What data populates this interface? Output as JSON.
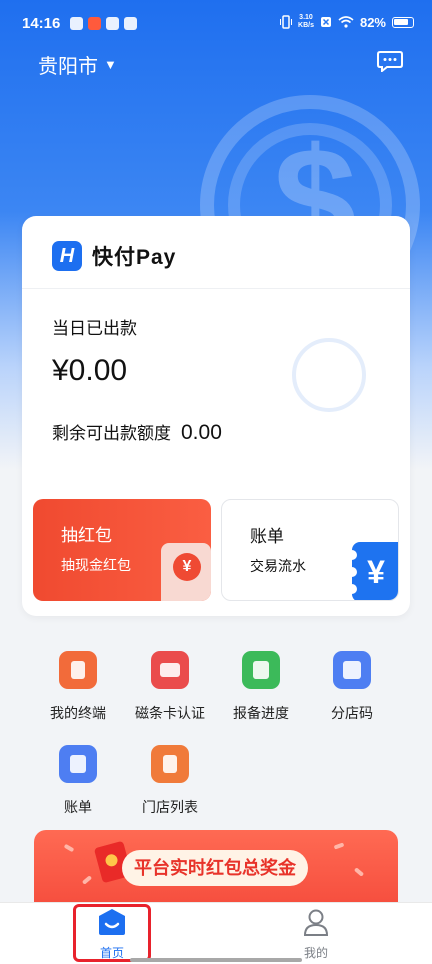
{
  "status_bar": {
    "time": "14:16",
    "net_speed_value": "3.10",
    "net_speed_unit": "KB/s",
    "battery": "82%"
  },
  "header": {
    "city": "贵阳市",
    "message_icon": "chat-bubble-icon"
  },
  "brand": {
    "logo_letter": "H",
    "name": "快付Pay"
  },
  "summary": {
    "today_label": "当日已出款",
    "today_amount": "¥0.00",
    "remaining_label": "剩余可出款额度",
    "remaining_value": "0.00"
  },
  "tiles": {
    "redpacket": {
      "title": "抽红包",
      "subtitle": "抽现金红包",
      "icon": "red-envelope-yen-icon"
    },
    "bill": {
      "title": "账单",
      "subtitle": "交易流水",
      "icon": "yen-ticket-icon"
    }
  },
  "grid": [
    {
      "label": "我的终端",
      "icon": "terminal-icon",
      "color": "#f26b3a"
    },
    {
      "label": "磁条卡认证",
      "icon": "card-icon",
      "color": "#ea4c4c"
    },
    {
      "label": "报备进度",
      "icon": "document-icon",
      "color": "#3cba5a"
    },
    {
      "label": "分店码",
      "icon": "qr-code-icon",
      "color": "#4e7ef2"
    },
    {
      "label": "账单",
      "icon": "receipt-icon",
      "color": "#4e7ef2"
    },
    {
      "label": "门店列表",
      "icon": "door-icon",
      "color": "#f07a3a"
    }
  ],
  "banner": {
    "text": "平台实时红包总奖金"
  },
  "tabbar": {
    "home_label": "首页",
    "me_label": "我的"
  },
  "colors": {
    "primary": "#1d6ff0",
    "accent_red": "#f04a30"
  }
}
